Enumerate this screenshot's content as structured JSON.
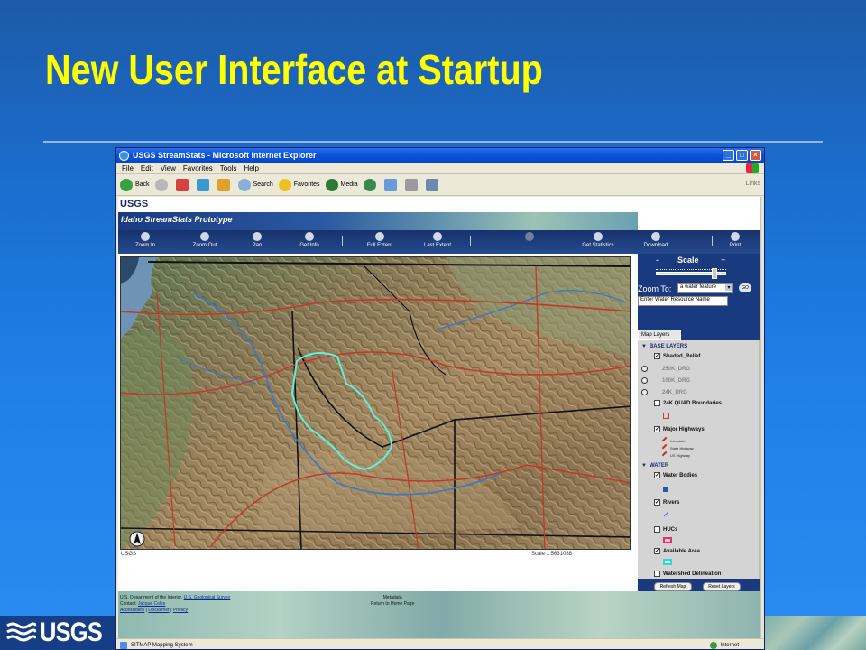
{
  "slide": {
    "title": "New User Interface at Startup",
    "logo_text": "USGS"
  },
  "window": {
    "title": "USGS StreamStats - Microsoft Internet Explorer",
    "menu": [
      "File",
      "Edit",
      "View",
      "Favorites",
      "Tools",
      "Help"
    ],
    "toolbar": {
      "back": "Back",
      "search": "Search",
      "favorites": "Favorites",
      "media": "Media",
      "links": "Links"
    },
    "status": {
      "left": "SITMAP Mapping System",
      "zone": "Internet"
    }
  },
  "app": {
    "org": "USGS",
    "banner_title": "Idaho StreamStats Prototype",
    "tools": [
      {
        "label": "Zoom In",
        "enabled": true
      },
      {
        "label": "Zoom Out",
        "enabled": true
      },
      {
        "label": "Pan",
        "enabled": true
      },
      {
        "label": "Get Info",
        "enabled": true
      },
      {
        "label": "Full Extent",
        "enabled": true
      },
      {
        "label": "Last Extent",
        "enabled": true
      },
      {
        "label": "",
        "enabled": false
      },
      {
        "label": "Get Statistics",
        "enabled": true
      }
    ],
    "right_tools": [
      {
        "label": "Download"
      },
      {
        "label": "Print"
      }
    ],
    "scale_panel": {
      "label": "Scale",
      "minus": "-",
      "plus": "+",
      "zoom_to_label": "Zoom To:",
      "zoom_to_value": "a water feature",
      "go": "GO",
      "water_input_value": "Enter Water Resource Name"
    },
    "map_status": {
      "left": "USGS",
      "scale": "Scale 1:5631088"
    },
    "layers": {
      "tab": "Map Layers",
      "base_group": "BASE LAYERS",
      "shaded_relief": "Shaded_Relief",
      "drg_250k": "250K_DRG",
      "drg_100k": "100K_DRG",
      "drg_24k": "24K_DRG",
      "quad_24k": "24K QUAD Boundaries",
      "major_highways": "Major Highways",
      "legend_interstate": "Interstate",
      "legend_state": "State Highway",
      "legend_us": "US Highway",
      "water_group": "WATER",
      "water_bodies": "Water Bodies",
      "rivers": "Rivers",
      "hucs": "HUCs",
      "available_area": "Available Area",
      "watershed": "Watershed Delineation",
      "refresh": "Refresh Map",
      "reset": "Reset Layers"
    },
    "footer": {
      "dept": "U.S. Department of the Interior,",
      "survey": "U.S. Geological Survey",
      "contact_label": "Contact:",
      "contact_name": "Jacque Coles",
      "accessibility": "Accessibility",
      "disclaimer": "Disclaimer",
      "privacy": "Privacy",
      "sep": "|",
      "metadata": "Metadata",
      "home": "Return to Home Page"
    }
  }
}
